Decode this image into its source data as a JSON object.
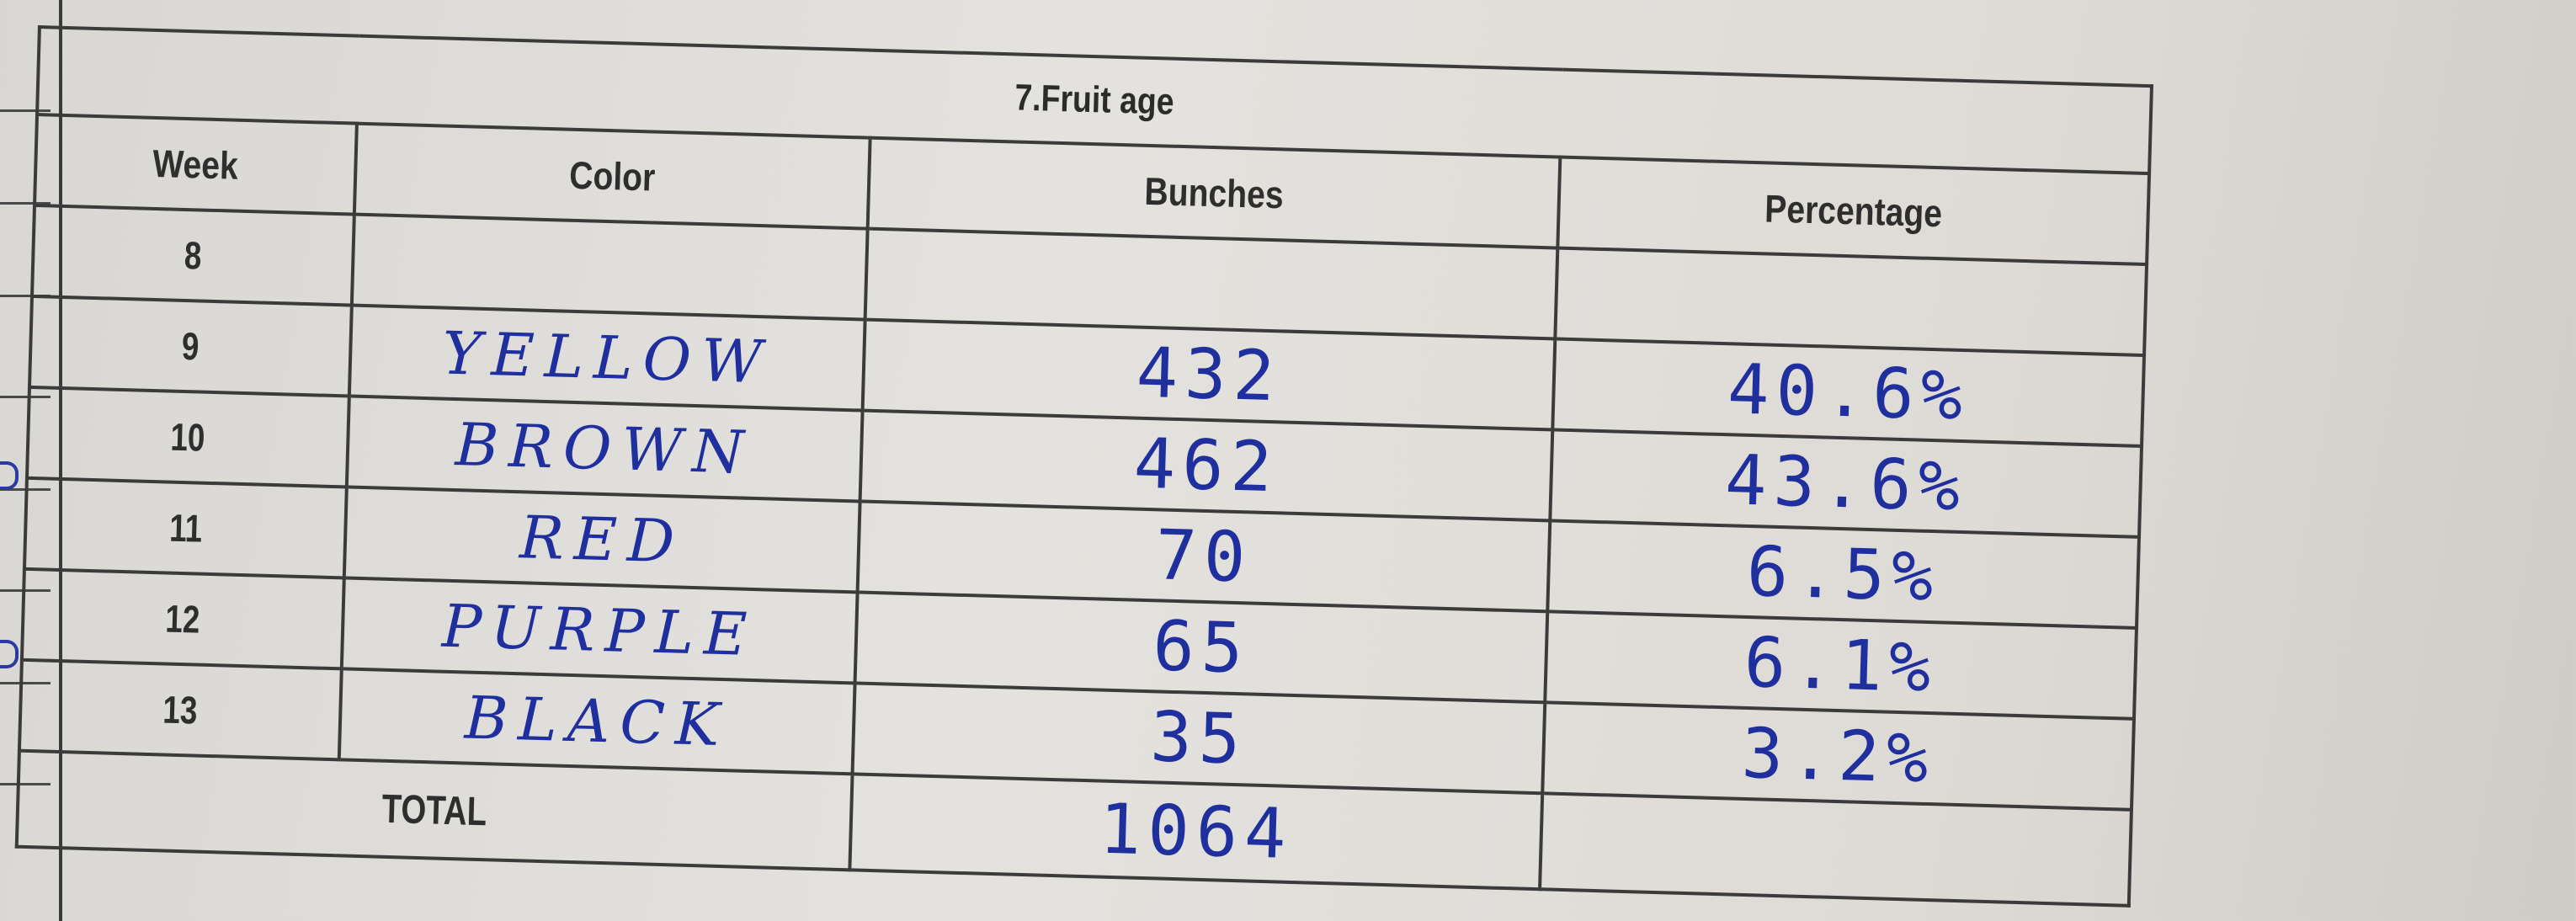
{
  "table": {
    "title": "7.Fruit age",
    "headers": {
      "week": "Week",
      "color": "Color",
      "bunches": "Bunches",
      "percentage": "Percentage"
    },
    "rows": [
      {
        "week": "8",
        "color": "",
        "bunches": "",
        "percentage": ""
      },
      {
        "week": "9",
        "color": "YELLOW",
        "bunches": "432",
        "percentage": "40.6%"
      },
      {
        "week": "10",
        "color": "BROWN",
        "bunches": "462",
        "percentage": "43.6%"
      },
      {
        "week": "11",
        "color": "RED",
        "bunches": "70",
        "percentage": "6.5%"
      },
      {
        "week": "12",
        "color": "PURPLE",
        "bunches": "65",
        "percentage": "6.1%"
      },
      {
        "week": "13",
        "color": "BLACK",
        "bunches": "35",
        "percentage": "3.2%"
      }
    ],
    "total": {
      "label": "TOTAL",
      "bunches": "1064",
      "percentage": ""
    }
  },
  "colors": {
    "ink": "#1f2f9e",
    "print": "#2e2e2e",
    "rule": "#3b3b3b",
    "paper": "#e2e0dc"
  }
}
